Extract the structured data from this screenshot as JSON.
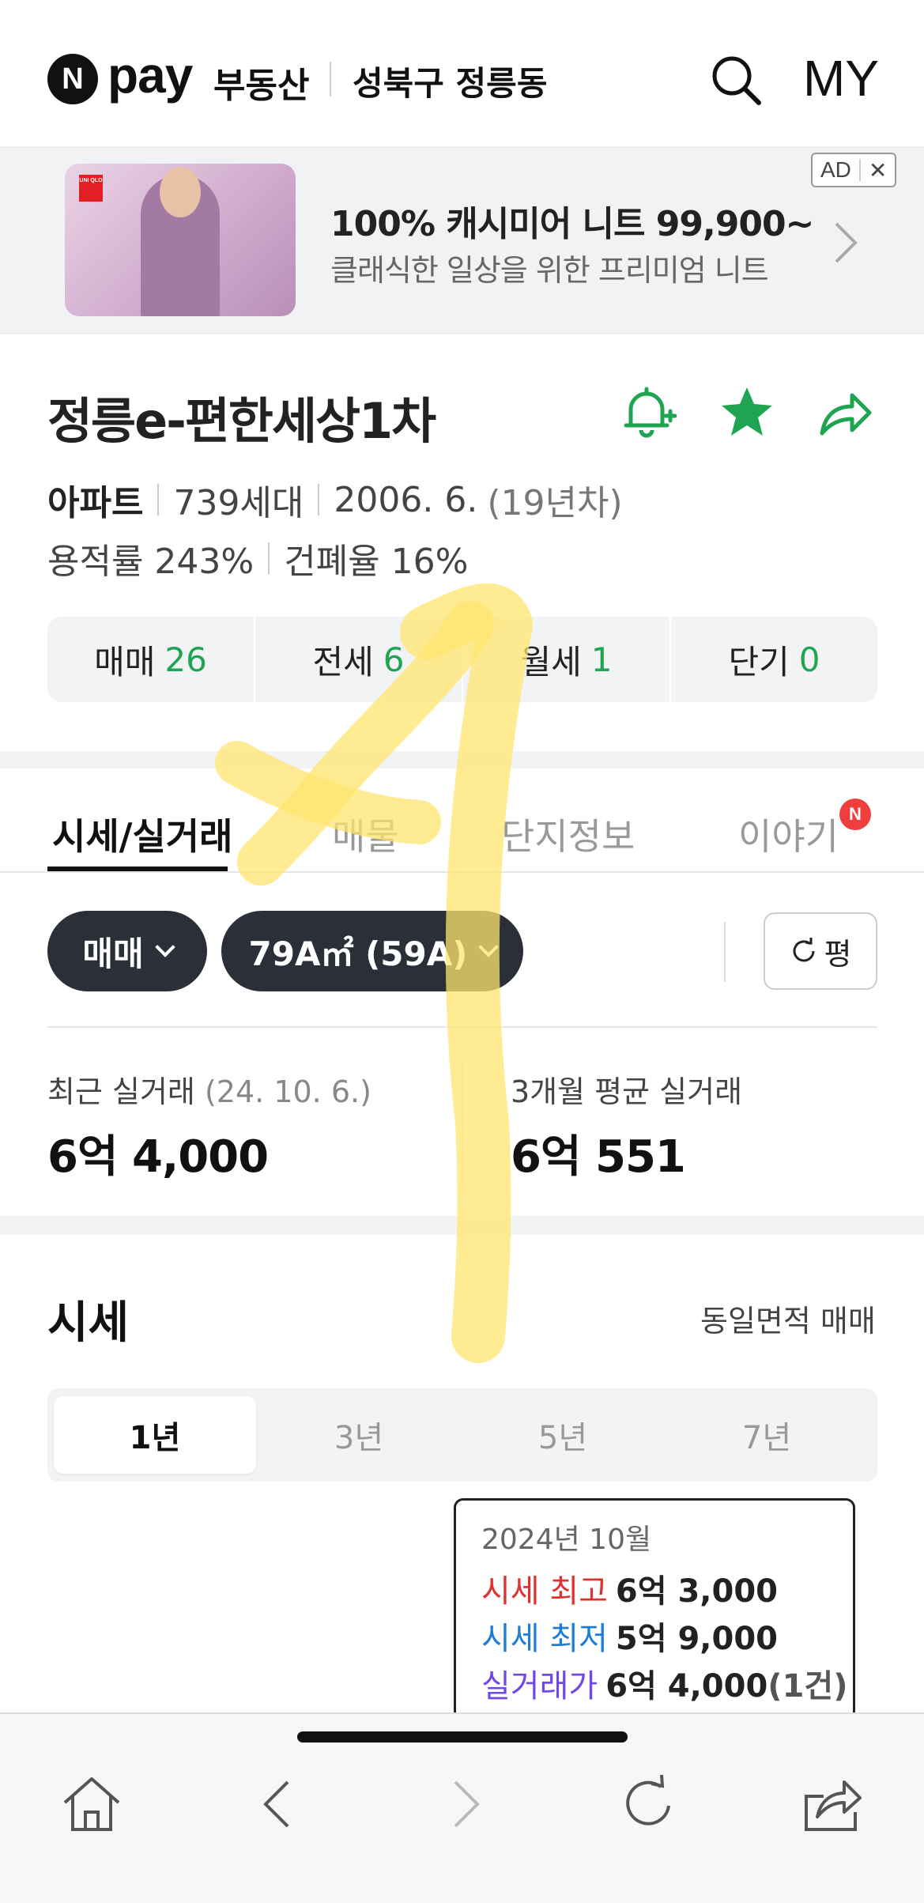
{
  "header": {
    "logo_n": "N",
    "logo_pay": "pay",
    "service": "부동산",
    "location": "성북구 정릉동",
    "my_label": "MY"
  },
  "ad": {
    "title": "100% 캐시미어 니트 99,900~",
    "subtitle": "클래식한 일상을 위한 프리미엄 니트",
    "badge": "AD",
    "close": "✕",
    "brand": "UNI QLO"
  },
  "complex": {
    "name": "정릉e-편한세상1차",
    "type": "아파트",
    "households": "739세대",
    "built": "2006. 6.",
    "age": "(19년차)",
    "far": "용적률 243%",
    "bcr": "건폐율 16%"
  },
  "trade_counts": [
    {
      "label": "매매",
      "count": "26"
    },
    {
      "label": "전세",
      "count": "6"
    },
    {
      "label": "월세",
      "count": "1"
    },
    {
      "label": "단기",
      "count": "0"
    }
  ],
  "tabs": [
    {
      "label": "시세/실거래",
      "active": true
    },
    {
      "label": "매물",
      "active": false
    },
    {
      "label": "단지정보",
      "active": false
    },
    {
      "label": "이야기",
      "active": false
    }
  ],
  "tab_badge": "N",
  "filters": {
    "trade_type": "매매",
    "area": "79A㎡ (59A)",
    "unit_toggle": "평"
  },
  "recent_trade": {
    "label": "최근 실거래",
    "date": "(24. 10. 6.)",
    "value": "6억 4,000"
  },
  "avg_trade": {
    "label": "3개월 평균 실거래",
    "value": "6억 551"
  },
  "price_section": {
    "heading": "시세",
    "link": "동일면적 매매",
    "periods": [
      "1년",
      "3년",
      "5년",
      "7년"
    ],
    "active_period": "1년"
  },
  "tooltip": {
    "date": "2024년 10월",
    "high_label": "시세 최고",
    "high_value": "6억 3,000",
    "low_label": "시세 최저",
    "low_value": "5억 9,000",
    "trade_label": "실거래가",
    "trade_value": "6억 4,000",
    "trade_count": "(1건)"
  },
  "colors": {
    "green": "#1fa552",
    "dark_pill": "#2b3038",
    "red": "#e03131",
    "blue": "#1c7ed6",
    "purple": "#7048e8",
    "highlighter": "#ffe66d"
  },
  "bottom_nav": [
    "home-icon",
    "back-icon",
    "forward-icon",
    "reload-icon",
    "share-icon"
  ]
}
